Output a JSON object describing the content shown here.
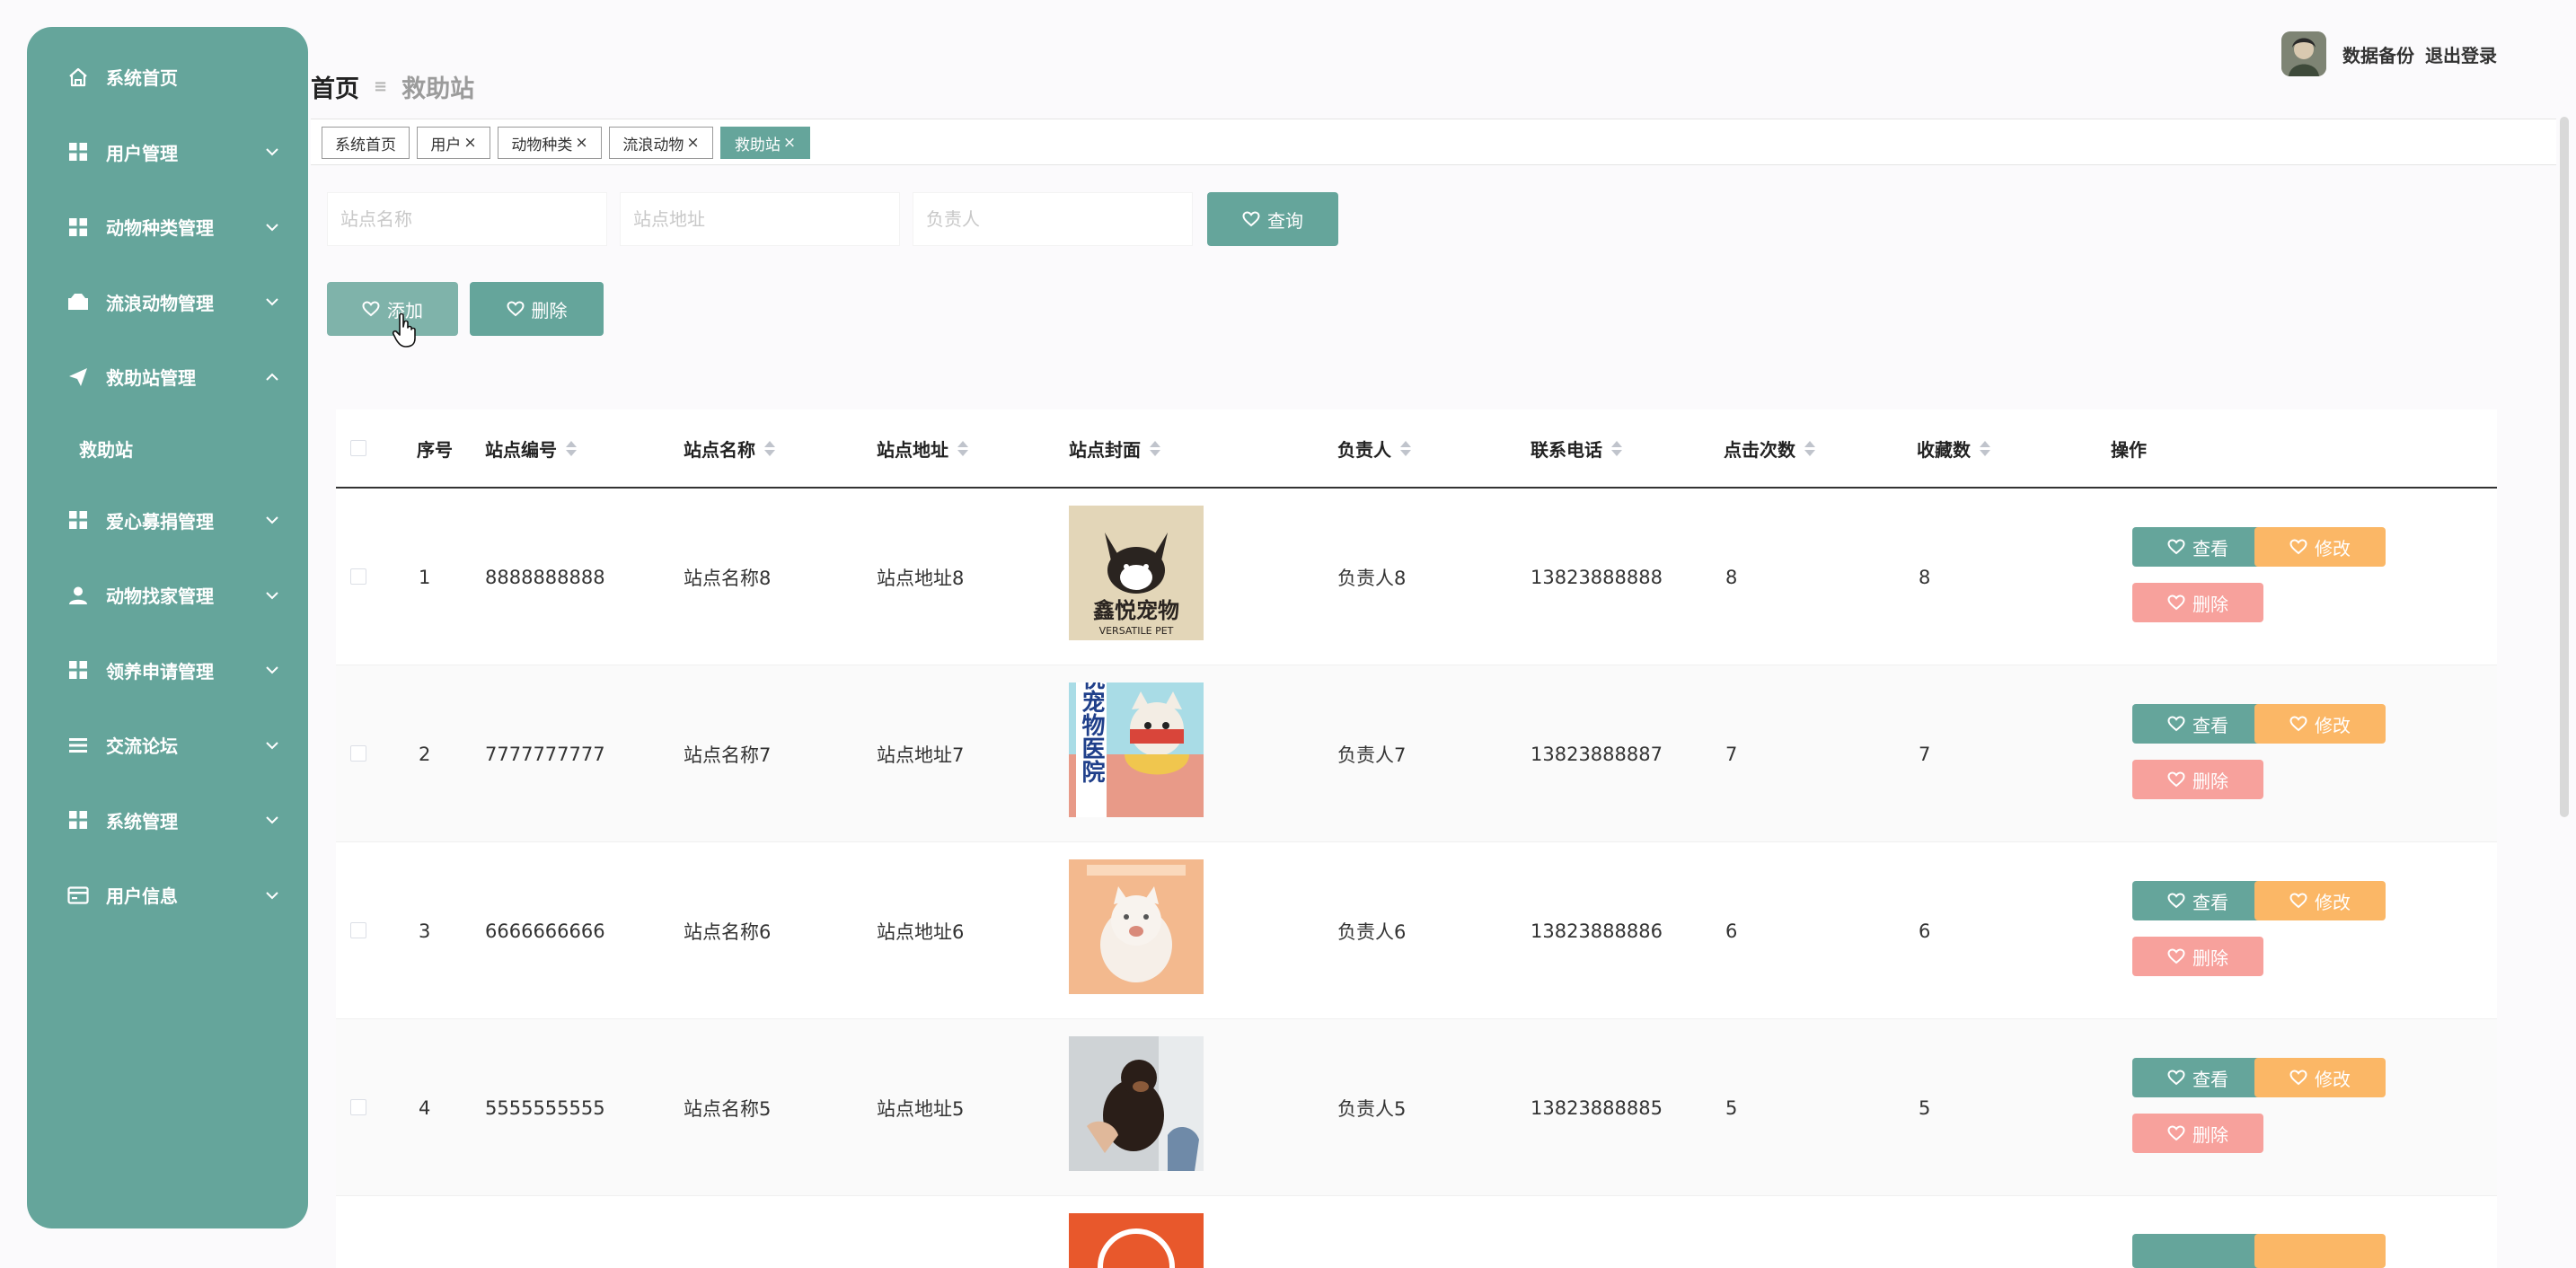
{
  "sidebar": {
    "items": [
      {
        "label": "系统首页",
        "icon": "home-icon"
      },
      {
        "label": "用户管理",
        "icon": "grid-icon"
      },
      {
        "label": "动物种类管理",
        "icon": "grid-icon"
      },
      {
        "label": "流浪动物管理",
        "icon": "truck-icon"
      },
      {
        "label": "救助站管理",
        "icon": "send-icon",
        "expanded": true,
        "children": [
          "救助站"
        ]
      },
      {
        "label": "爱心募捐管理",
        "icon": "grid-icon"
      },
      {
        "label": "动物找家管理",
        "icon": "user-icon"
      },
      {
        "label": "领养申请管理",
        "icon": "grid-icon"
      },
      {
        "label": "交流论坛",
        "icon": "list-icon"
      },
      {
        "label": "系统管理",
        "icon": "grid-icon"
      },
      {
        "label": "用户信息",
        "icon": "card-icon"
      }
    ]
  },
  "breadcrumb": {
    "home": "首页",
    "current": "救助站"
  },
  "header": {
    "backup": "数据备份",
    "logout": "退出登录"
  },
  "tabs": [
    {
      "label": "系统首页",
      "closable": false
    },
    {
      "label": "用户",
      "closable": true
    },
    {
      "label": "动物种类",
      "closable": true
    },
    {
      "label": "流浪动物",
      "closable": true
    },
    {
      "label": "救助站",
      "closable": true,
      "active": true
    }
  ],
  "close_glyph": "×",
  "search": {
    "name_placeholder": "站点名称",
    "address_placeholder": "站点地址",
    "manager_placeholder": "负责人",
    "query_label": "查询"
  },
  "toolbar": {
    "add_label": "添加",
    "delete_label": "删除"
  },
  "table": {
    "columns": [
      "序号",
      "站点编号",
      "站点名称",
      "站点地址",
      "站点封面",
      "负责人",
      "联系电话",
      "点击次数",
      "收藏数",
      "操作"
    ],
    "actions": {
      "view": "查看",
      "edit": "修改",
      "delete": "删除"
    },
    "cover_labels": {
      "row1_text": "鑫悦宠物",
      "row1_sub": "VERSATILE PET",
      "row2_text": "心悦宠物医院"
    },
    "rows": [
      {
        "index": "1",
        "code": "8888888888",
        "name": "站点名称8",
        "address": "站点地址8",
        "manager": "负责人8",
        "phone": "13823888888",
        "clicks": "8",
        "favorites": "8"
      },
      {
        "index": "2",
        "code": "7777777777",
        "name": "站点名称7",
        "address": "站点地址7",
        "manager": "负责人7",
        "phone": "13823888887",
        "clicks": "7",
        "favorites": "7"
      },
      {
        "index": "3",
        "code": "6666666666",
        "name": "站点名称6",
        "address": "站点地址6",
        "manager": "负责人6",
        "phone": "13823888886",
        "clicks": "6",
        "favorites": "6"
      },
      {
        "index": "4",
        "code": "5555555555",
        "name": "站点名称5",
        "address": "站点地址5",
        "manager": "负责人5",
        "phone": "13823888885",
        "clicks": "5",
        "favorites": "5"
      }
    ]
  },
  "colors": {
    "primary": "#65a59b",
    "warning": "#fbb766",
    "danger": "#f7a19c",
    "primary_light": "#7fb3aa"
  }
}
